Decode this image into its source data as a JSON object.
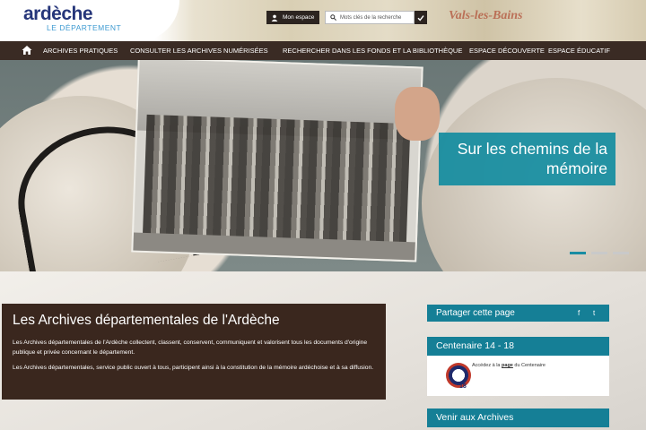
{
  "header": {
    "logo_word": "ardèche",
    "logo_sub": "LE DÉPARTEMENT",
    "background_text": "Vals-les-Bains",
    "account_label": "Mon espace",
    "search_placeholder": "Mots clés de la recherche"
  },
  "nav": {
    "items": [
      {
        "label": "ARCHIVES PRATIQUES"
      },
      {
        "label": "CONSULTER LES ARCHIVES NUMÉRISÉES"
      },
      {
        "label": "RECHERCHER DANS LES FONDS ET LA BIBLIOTHÈQUE"
      },
      {
        "label": "ESPACE DÉCOUVERTE"
      },
      {
        "label": "ESPACE ÉDUCATIF"
      }
    ]
  },
  "hero": {
    "caption": "Sur les chemins de la mémoire",
    "slides_count": 3,
    "active_slide": 1
  },
  "main": {
    "title": "Les Archives départementales de l'Ardèche",
    "paragraph1": "Les Archives départementales de l'Ardèche collectent, classent, conservent, communiquent et valorisent tous les documents d'origine publique et privée concernant le département.",
    "paragraph2": "Les Archives départementales, service public ouvert à tous, participent ainsi à la constitution de la mémoire ardéchoise et à sa diffusion."
  },
  "sidebar": {
    "share_label": "Partager cette page",
    "social": [
      "f",
      "t"
    ],
    "centenaire_title": "Centenaire 14 - 18",
    "centenaire_text_before": "Accédez à la",
    "centenaire_link": "page",
    "centenaire_text_after": "du Centenaire",
    "badge_number": "18",
    "venir_title": "Venir aux Archives"
  },
  "colors": {
    "nav_bg": "#3a2b24",
    "accent_teal": "#157f96",
    "main_box_bg": "#3a271e",
    "logo_blue": "#26367a"
  }
}
